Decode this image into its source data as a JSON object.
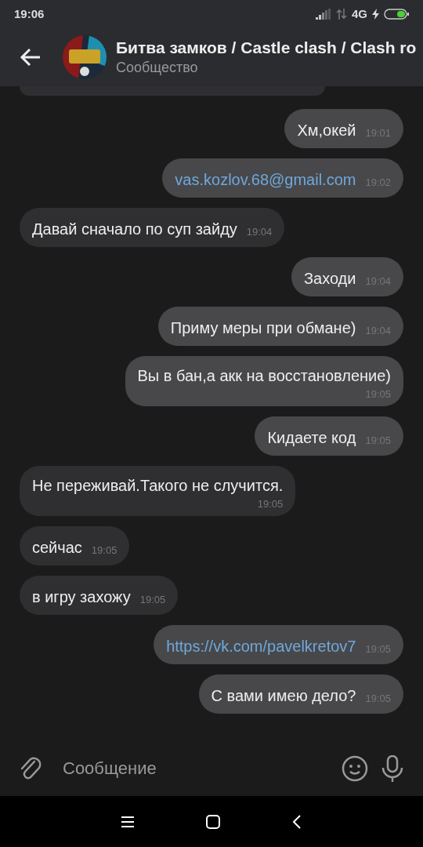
{
  "status_bar": {
    "time": "19:06",
    "network": "4G"
  },
  "header": {
    "title": "Битва замков / Castle clash / Clash ro",
    "subtitle": "Сообщество"
  },
  "messages": [
    {
      "text": "Хм,окей",
      "time": "19:01",
      "outgoing": true,
      "kind": "text"
    },
    {
      "text": "vas.kozlov.68@gmail.com",
      "time": "19:02",
      "outgoing": true,
      "kind": "link"
    },
    {
      "text": "Давай сначало по суп зайду",
      "time": "19:04",
      "outgoing": false,
      "kind": "text"
    },
    {
      "text": "Заходи",
      "time": "19:04",
      "outgoing": true,
      "kind": "text"
    },
    {
      "text": "Приму меры при обмане)",
      "time": "19:04",
      "outgoing": true,
      "kind": "text"
    },
    {
      "text": "Вы в бан,а акк на восстановление)",
      "time": "19:05",
      "outgoing": true,
      "kind": "wrapped"
    },
    {
      "text": "Кидаете код",
      "time": "19:05",
      "outgoing": true,
      "kind": "text"
    },
    {
      "text": "Не переживай.Такого не случится.",
      "time": "19:05",
      "outgoing": false,
      "kind": "wrapped"
    },
    {
      "text": "сейчас",
      "time": "19:05",
      "outgoing": false,
      "kind": "text"
    },
    {
      "text": "в игру захожу",
      "time": "19:05",
      "outgoing": false,
      "kind": "text"
    },
    {
      "text": "https://vk.com/pavelkretov7",
      "time": "19:05",
      "outgoing": true,
      "kind": "link"
    },
    {
      "text": "С вами имею дело?",
      "time": "19:05",
      "outgoing": true,
      "kind": "text"
    }
  ],
  "composer": {
    "placeholder": "Сообщение"
  }
}
